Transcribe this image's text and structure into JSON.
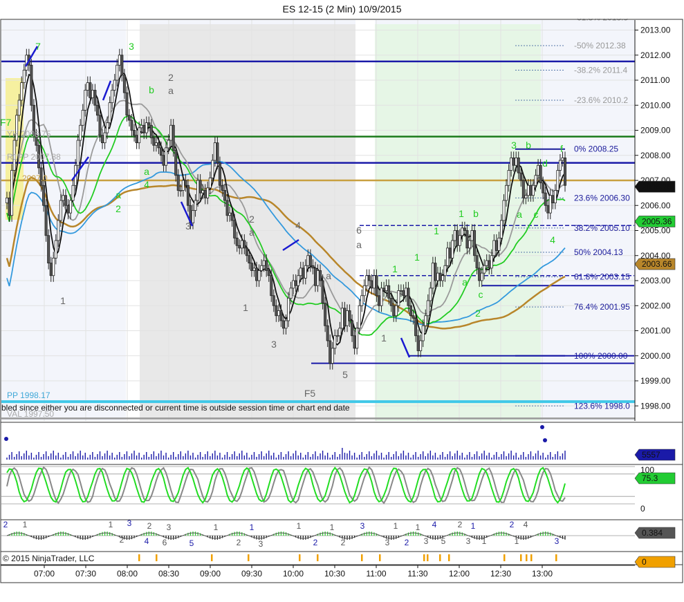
{
  "title": "ES 12-15 (2 Min)  10/9/2015",
  "copyright": "© 2015 NinjaTrader, LLC",
  "status_message": "bled since either you are disconnected or current time is outside session time or chart end date",
  "price_labels": {
    "last": "2006.75",
    "blue_ma": "2005.36",
    "brown_ma": "2003.66",
    "volume": "5557",
    "stoch": "75.3",
    "macd": "0.384",
    "bottom": "0"
  },
  "level_labels": {
    "yh": "YH 2008.75",
    "r1pp": "R1PP 2007.88",
    "pp": "PP 1998.17",
    "val": "VAL 1997.50",
    "mid": "2007.0",
    "f7": "F7"
  },
  "fib_labels": [
    "-61.8%  2013.5",
    "-50%  2012.38",
    "-38.2%  2011.4",
    "-23.6%  2010.2",
    "0%  2008.25",
    "23.6%  2006.30",
    "38.2%  2005.10",
    "50%  2004.13",
    "61.8%  2003.15",
    "76.4%  2001.95",
    "100%  2000.00",
    "123.6%  1998.0"
  ],
  "osc_scale": [
    "100",
    "0"
  ],
  "wave_labels_green": [
    "7",
    "3",
    "b",
    "a",
    "4",
    "a",
    "2",
    "3",
    "b",
    "f",
    "1",
    "b",
    "1",
    "1",
    "1",
    "a",
    "c",
    "4",
    "d",
    "a",
    "c",
    "2"
  ],
  "wave_labels_gray": [
    "2",
    "a",
    "1",
    "3",
    "2",
    "a",
    "1",
    "4",
    "3",
    "a",
    "F5",
    "6",
    "a",
    "5",
    "1"
  ],
  "macd_labels": [
    "2",
    "1",
    "1",
    "3",
    "2",
    "2",
    "4",
    "3",
    "6",
    "5",
    "1",
    "2",
    "1",
    "3",
    "1",
    "2",
    "1",
    "2",
    "3",
    "3",
    "1",
    "2",
    "1",
    "3",
    "4",
    "5",
    "2",
    "1",
    "3",
    "1",
    "2",
    "1",
    "4",
    "3"
  ],
  "chart_data": {
    "type": "candlestick",
    "title": "ES 12-15 (2 Min)  10/9/2015",
    "xlabel": "",
    "ylabel": "",
    "x_ticks": [
      "07:00",
      "07:30",
      "08:00",
      "08:30",
      "09:00",
      "09:30",
      "10:00",
      "10:30",
      "11:00",
      "11:30",
      "12:00",
      "12:30",
      "13:00"
    ],
    "y_ticks": [
      "2013.00",
      "2012.00",
      "2011.00",
      "2010.00",
      "2009.00",
      "2008.00",
      "2007.00",
      "2006.00",
      "2005.00",
      "2004.00",
      "2003.00",
      "2002.00",
      "2001.00",
      "2000.00",
      "1999.00",
      "1998.00"
    ],
    "ylim": [
      1997.5,
      2013.4
    ],
    "closes": [
      2006.3,
      2005.6,
      2007.4,
      2008.6,
      2009.6,
      2010.2,
      2010.9,
      2011.4,
      2012.0,
      2011.6,
      2010.0,
      2008.8,
      2008.4,
      2007.5,
      2006.8,
      2006.0,
      2004.8,
      2003.7,
      2003.2,
      2003.9,
      2004.6,
      2005.4,
      2006.2,
      2006.4,
      2006.0,
      2005.7,
      2006.2,
      2006.8,
      2007.6,
      2008.6,
      2009.2,
      2009.8,
      2010.6,
      2010.9,
      2010.3,
      2010.6,
      2010.0,
      2009.6,
      2008.8,
      2008.5,
      2008.9,
      2009.3,
      2010.1,
      2010.6,
      2011.0,
      2011.6,
      2012.0,
      2011.2,
      2010.5,
      2009.6,
      2009.4,
      2009.0,
      2008.8,
      2008.5,
      2009.1,
      2009.2,
      2008.9,
      2009.3,
      2009.2,
      2008.7,
      2008.4,
      2008.5,
      2008.3,
      2008.0,
      2007.6,
      2008.3,
      2008.6,
      2009.2,
      2008.2,
      2007.2,
      2006.6,
      2006.6,
      2007.0,
      2006.8,
      2006.0,
      2005.3,
      2005.8,
      2006.2,
      2007.0,
      2006.5,
      2006.6,
      2006.3,
      2006.7,
      2007.1,
      2007.8,
      2008.5,
      2007.7,
      2006.8,
      2006.6,
      2006.2,
      2005.6,
      2005.7,
      2005.4,
      2004.7,
      2004.4,
      2004.3,
      2004.6,
      2004.3,
      2004.0,
      2003.7,
      2003.4,
      2003.5,
      2003.0,
      2003.4,
      2003.6,
      2003.8,
      2003.4,
      2003.2,
      2002.4,
      2002.0,
      2001.6,
      2001.8,
      2001.4,
      2001.1,
      2001.4,
      2002.3,
      2002.7,
      2003.0,
      2002.8,
      2003.2,
      2003.5,
      2003.1,
      2003.6,
      2004.0,
      2003.6,
      2003.5,
      2002.8,
      2003.4,
      2003.0,
      2002.1,
      2001.2,
      2000.6,
      1999.7,
      2000.3,
      2000.8,
      2000.8,
      2001.1,
      2001.9,
      2001.2,
      2001.8,
      2001.4,
      2000.8,
      2000.3,
      2001.1,
      2002.0,
      2002.4,
      2002.8,
      2003.2,
      2003.0,
      2002.7,
      2003.2,
      2002.4,
      2002.0,
      2002.7,
      2002.6,
      2002.8,
      2002.3,
      2002.0,
      2001.6,
      2002.0,
      2002.6,
      2002.6,
      2002.4,
      2002.7,
      2002.0,
      2001.6,
      2001.5,
      2000.8,
      2000.2,
      2000.6,
      2001.2,
      2001.6,
      2002.2,
      2002.7,
      2003.7,
      2003.0,
      2003.3,
      2003.0,
      2003.2,
      2003.6,
      2004.3,
      2003.9,
      2004.6,
      2005.0,
      2004.4,
      2004.8,
      2005.1,
      2005.0,
      2004.3,
      2004.6,
      2005.0,
      2004.0,
      2003.5,
      2003.0,
      2003.3,
      2003.6,
      2003.8,
      2003.5,
      2004.0,
      2004.6,
      2004.2,
      2004.7,
      2005.4,
      2006.2,
      2006.8,
      2007.4,
      2007.9,
      2007.6,
      2007.9,
      2007.3,
      2007.0,
      2006.3,
      2006.4,
      2006.8,
      2006.4,
      2006.8,
      2007.2,
      2007.6,
      2006.9,
      2006.5,
      2006.0,
      2005.7,
      2006.4,
      2006.1,
      2006.6,
      2007.4,
      2007.8,
      2007.9,
      2006.8
    ],
    "highs_lows_note": "",
    "series": [
      {
        "name": "",
        "kind": "black_ma",
        "color": "#111111"
      },
      {
        "name": "",
        "kind": "gray_ma",
        "color": "#9a9a9a"
      },
      {
        "name": "",
        "kind": "green_ma",
        "color": "#22cc22"
      },
      {
        "name": "",
        "kind": "blue_ma",
        "color": "#3399dd"
      },
      {
        "name": "",
        "kind": "brown_ma",
        "color": "#b8862a"
      }
    ],
    "horizontal_levels": [
      {
        "value": 2011.75,
        "color": "#1a1aa8"
      },
      {
        "value": 2008.75,
        "color": "#1a7a1a"
      },
      {
        "value": 2007.7,
        "color": "#1a1aa8"
      },
      {
        "value": 2007.0,
        "color": "#c8a040"
      },
      {
        "value": 1998.17,
        "color": "#40c8e8"
      },
      {
        "value": 1997.5,
        "color": "#999999"
      }
    ],
    "volume_max": 3
  },
  "colors": {
    "up_candle": "#ffffff",
    "down_candle": "#444444",
    "session_gray": "#e8e8e8",
    "session_green": "#e6f6e6",
    "session_yellow": "#f6f0a0",
    "fib": "#1a1a9a",
    "green_label": "#22cc22",
    "gray_label": "#666666"
  }
}
